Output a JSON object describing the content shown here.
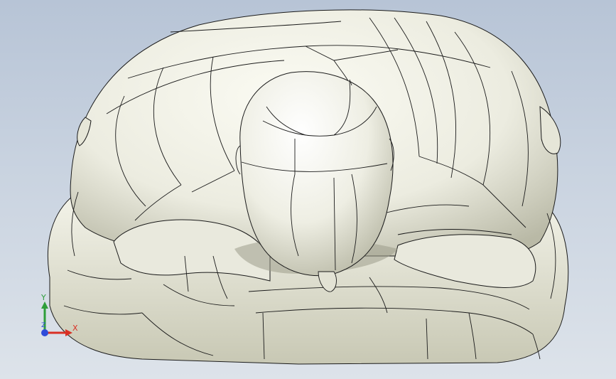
{
  "viewport": {
    "model_description_icon": "3d-mannequin-model",
    "background_top": "#b7c4d6",
    "background_bottom": "#dde3ea",
    "model_fill": "#ecece0",
    "edge_color": "#1a1a1a"
  },
  "triad": {
    "x_label": "X",
    "y_label": "Y",
    "z_label": "Z",
    "x_color": "#d93025",
    "y_color": "#2e9e3a",
    "z_color": "#2e4bd9"
  }
}
